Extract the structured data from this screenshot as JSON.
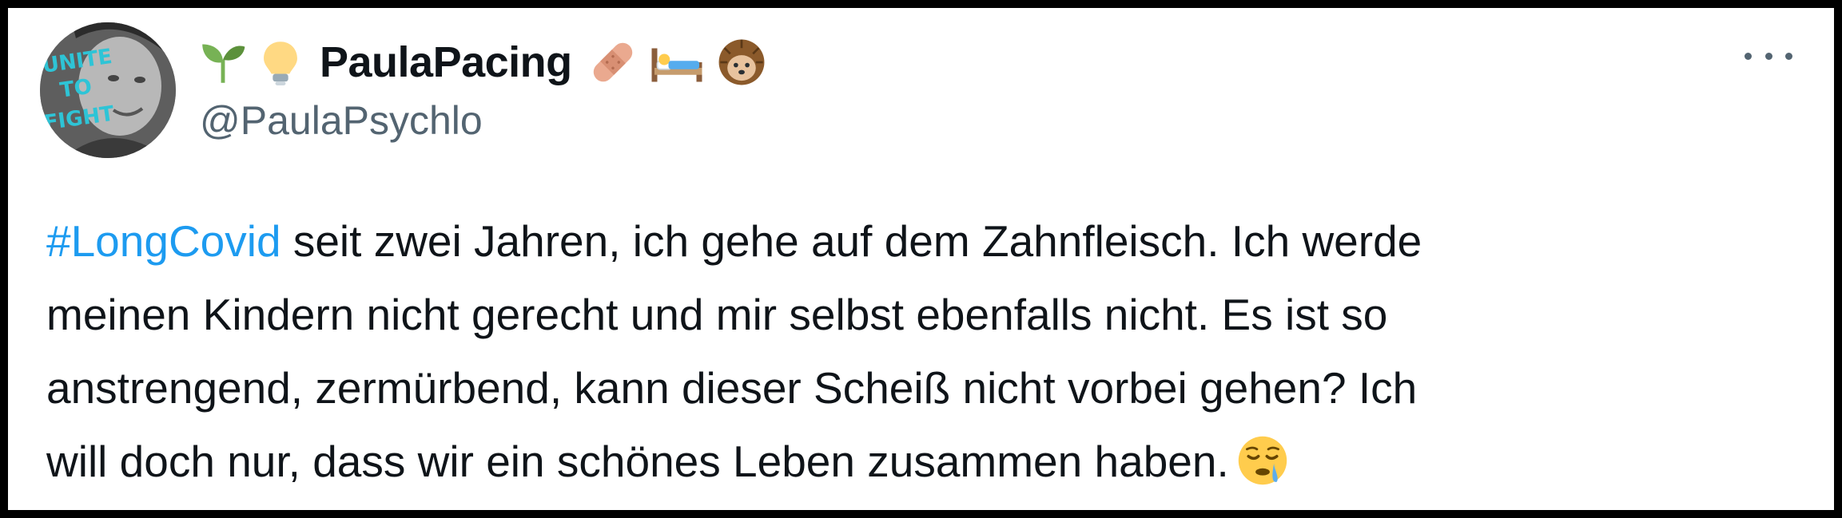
{
  "tweet": {
    "author": {
      "name_prefix_icons": [
        "seedling-icon",
        "lightbulb-icon"
      ],
      "display_name": "PaulaPacing",
      "name_suffix_icons": [
        "adhesive-bandage-icon",
        "bed-icon",
        "hedgehog-icon"
      ],
      "handle": "@PaulaPsychlo",
      "avatar_text": [
        "UNITE",
        "TO",
        "FIGHT"
      ]
    },
    "more_menu_icon": "more-horizontal-icon",
    "text": {
      "hashtag": "#LongCovid",
      "line1_rest": " seit zwei Jahren, ich gehe auf dem Zahnfleisch. Ich werde",
      "line2": "meinen Kindern nicht gerecht und mir selbst ebenfalls nicht. Es ist so",
      "line3": "anstrengend, zermürbend, kann dieser Scheiß nicht vorbei gehen? Ich",
      "line4": "will doch nur, dass wir ein schönes Leben zusammen haben.",
      "end_emoji": "sleepy-face-icon"
    },
    "colors": {
      "hashtag": "#1d9bf0",
      "text": "#0f1419",
      "secondary": "#536471",
      "frame": "#000000"
    }
  }
}
